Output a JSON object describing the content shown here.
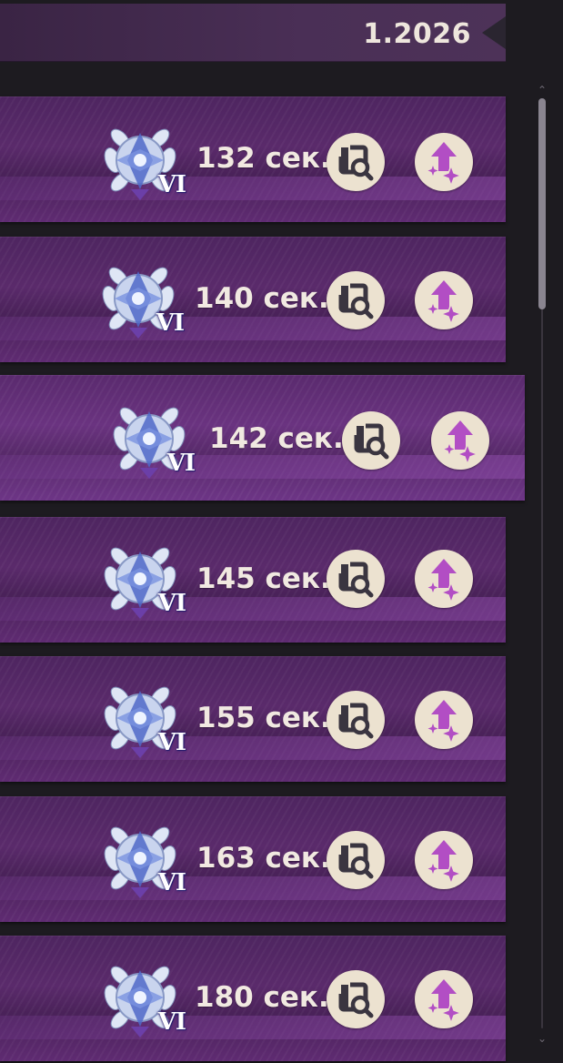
{
  "header": {
    "version": "1.2026"
  },
  "icons": {
    "badge": "constellation-rank-badge-icon",
    "details_button": "inspect-magnifier-icon",
    "upgrade_button": "sparkle-upgrade-arrow-icon"
  },
  "colors": {
    "row_bg": "#54286a",
    "row_selected_bg": "#633080",
    "button_bg": "#ece2d0",
    "details_icon": "#3a3540",
    "upgrade_icon": "#b24ec4",
    "text": "#f1e9e1"
  },
  "rows": [
    {
      "rank": "VI",
      "time": "132 сек."
    },
    {
      "rank": "VI",
      "time": "140 сек."
    },
    {
      "rank": "VI",
      "time": "142 сек.",
      "selected": true
    },
    {
      "rank": "VI",
      "time": "145 сек."
    },
    {
      "rank": "VI",
      "time": "155 сек."
    },
    {
      "rank": "VI",
      "time": "163 сек."
    },
    {
      "rank": "VI",
      "time": "180 сек."
    }
  ],
  "scrollbar": {
    "up_arrow": "⌃",
    "down_arrow": "⌄"
  }
}
